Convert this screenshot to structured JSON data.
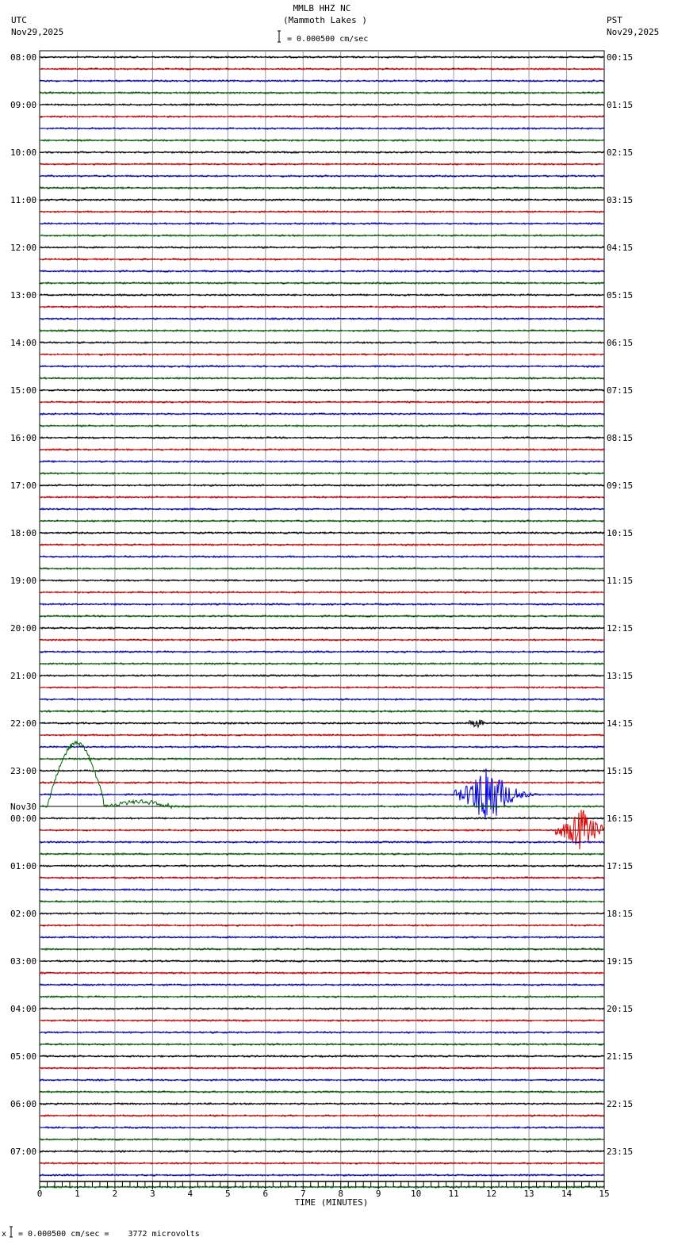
{
  "header": {
    "title": "MMLB HHZ NC",
    "subtitle": "(Mammoth Lakes )",
    "left_tz": "UTC",
    "left_date": "Nov29,2025",
    "right_tz": "PST",
    "right_date": "Nov29,2025",
    "scale_text": "= 0.000500 cm/sec"
  },
  "footer": {
    "scale_text": "= 0.000500 cm/sec =    3772 microvolts",
    "prefix": "x"
  },
  "chart_data": {
    "type": "line",
    "title": "MMLB HHZ NC (Mammoth Lakes )",
    "xlabel": "TIME (MINUTES)",
    "xlim": [
      0,
      15
    ],
    "x_ticks": [
      "0",
      "1",
      "2",
      "3",
      "4",
      "5",
      "6",
      "7",
      "8",
      "9",
      "10",
      "11",
      "12",
      "13",
      "14",
      "15"
    ],
    "traces_per_hour": 4,
    "trace_colors": [
      "#000000",
      "#e00000",
      "#0000e0",
      "#006400"
    ],
    "date_change_label": "Nov30",
    "left_labels": [
      "08:00",
      "09:00",
      "10:00",
      "11:00",
      "12:00",
      "13:00",
      "14:00",
      "15:00",
      "16:00",
      "17:00",
      "18:00",
      "19:00",
      "20:00",
      "21:00",
      "22:00",
      "23:00",
      "00:00",
      "01:00",
      "02:00",
      "03:00",
      "04:00",
      "05:00",
      "06:00",
      "07:00"
    ],
    "right_labels": [
      "00:15",
      "01:15",
      "02:15",
      "03:15",
      "04:15",
      "05:15",
      "06:15",
      "07:15",
      "08:15",
      "09:15",
      "10:15",
      "11:15",
      "12:15",
      "13:15",
      "14:15",
      "15:15",
      "16:15",
      "17:15",
      "18:15",
      "19:15",
      "20:15",
      "21:15",
      "22:15",
      "23:15"
    ],
    "events": [
      {
        "trace": 62,
        "start_min": 11.0,
        "end_min": 13.2,
        "peak_min": 11.9,
        "amplitude": 5.0
      },
      {
        "trace": 65,
        "start_min": 13.7,
        "end_min": 15.0,
        "peak_min": 14.4,
        "amplitude": 3.0
      },
      {
        "trace": 56,
        "start_min": 11.4,
        "end_min": 11.8,
        "peak_min": 11.55,
        "amplitude": 0.6
      },
      {
        "trace": 63,
        "start_min": 0.2,
        "end_min": 3.5,
        "peak_min": 0.7,
        "amplitude": 6.0,
        "kind": "long-period"
      }
    ]
  }
}
